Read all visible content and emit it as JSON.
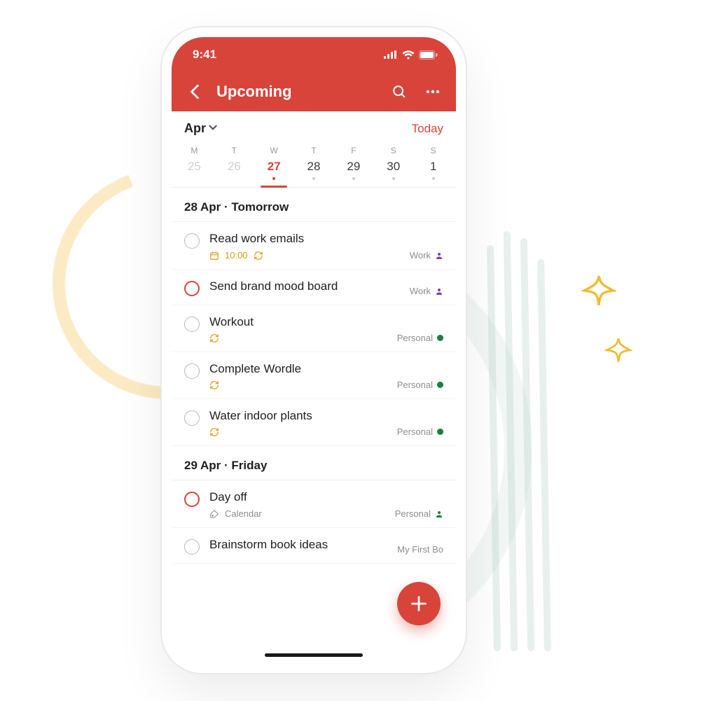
{
  "status": {
    "time": "9:41"
  },
  "nav": {
    "title": "Upcoming"
  },
  "subhead": {
    "month": "Apr",
    "today": "Today"
  },
  "week": {
    "labels": [
      "M",
      "T",
      "W",
      "T",
      "F",
      "S",
      "S"
    ],
    "nums": [
      "25",
      "26",
      "27",
      "28",
      "29",
      "30",
      "1"
    ],
    "muted": [
      true,
      true,
      false,
      false,
      false,
      false,
      false
    ],
    "selectedIndex": 2,
    "dots": [
      false,
      false,
      true,
      true,
      true,
      true,
      true
    ]
  },
  "sections": [
    {
      "title": "28 Apr · Tomorrow",
      "tasks": [
        {
          "title": "Read work emails",
          "priority": false,
          "time": "10:00",
          "recurring": true,
          "calendarIcon": true,
          "calendarLabel": null,
          "project": {
            "name": "Work",
            "color": "#7b3fb3",
            "icon": "person"
          }
        },
        {
          "title": "Send brand mood board",
          "priority": true,
          "time": null,
          "recurring": false,
          "calendarIcon": false,
          "calendarLabel": null,
          "project": {
            "name": "Work",
            "color": "#7b3fb3",
            "icon": "person"
          }
        },
        {
          "title": "Workout",
          "priority": false,
          "time": null,
          "recurring": true,
          "calendarIcon": false,
          "calendarLabel": null,
          "project": {
            "name": "Personal",
            "color": "#17803d",
            "icon": "dot"
          }
        },
        {
          "title": "Complete Wordle",
          "priority": false,
          "time": null,
          "recurring": true,
          "calendarIcon": false,
          "calendarLabel": null,
          "project": {
            "name": "Personal",
            "color": "#17803d",
            "icon": "dot"
          }
        },
        {
          "title": "Water indoor plants",
          "priority": false,
          "time": null,
          "recurring": true,
          "calendarIcon": false,
          "calendarLabel": null,
          "project": {
            "name": "Personal",
            "color": "#17803d",
            "icon": "dot"
          }
        }
      ]
    },
    {
      "title": "29 Apr · Friday",
      "tasks": [
        {
          "title": "Day off",
          "priority": true,
          "time": null,
          "recurring": false,
          "calendarIcon": false,
          "calendarLabel": "Calendar",
          "project": {
            "name": "Personal",
            "color": "#17803d",
            "icon": "person"
          }
        },
        {
          "title": "Brainstorm book ideas",
          "priority": false,
          "time": null,
          "recurring": false,
          "calendarIcon": false,
          "calendarLabel": null,
          "project": {
            "name": "My First Bo",
            "color": "#888",
            "icon": "none"
          }
        }
      ]
    }
  ]
}
